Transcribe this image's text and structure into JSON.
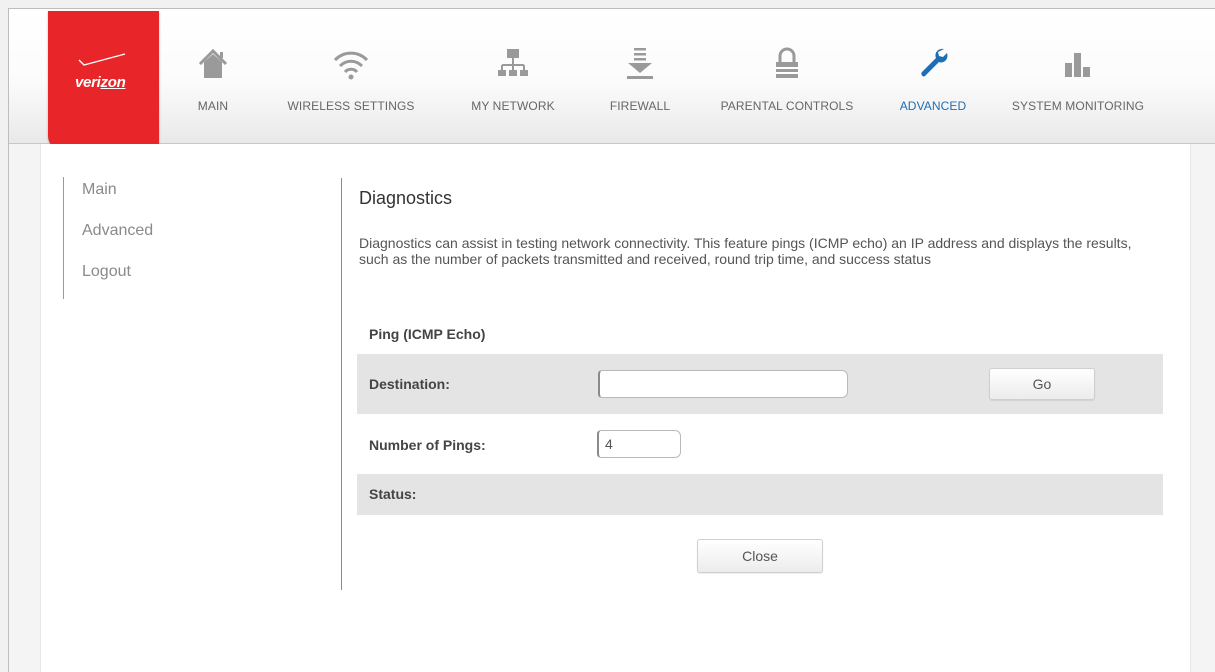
{
  "brand": {
    "logo_text_a": "veri",
    "logo_text_b": "zon"
  },
  "nav": {
    "items": [
      {
        "label": "MAIN",
        "icon": "home-icon"
      },
      {
        "label": "WIRELESS SETTINGS",
        "icon": "wifi-icon"
      },
      {
        "label": "MY NETWORK",
        "icon": "network-icon"
      },
      {
        "label": "FIREWALL",
        "icon": "firewall-icon"
      },
      {
        "label": "PARENTAL CONTROLS",
        "icon": "lock-icon"
      },
      {
        "label": "ADVANCED",
        "icon": "wrench-icon"
      },
      {
        "label": "SYSTEM MONITORING",
        "icon": "bar-chart-icon"
      }
    ],
    "active": "ADVANCED"
  },
  "sidebar": {
    "items": [
      {
        "label": "Main"
      },
      {
        "label": "Advanced"
      },
      {
        "label": "Logout"
      }
    ]
  },
  "page": {
    "title": "Diagnostics",
    "description": "Diagnostics can assist in testing network connectivity. This feature pings (ICMP echo) an IP address and displays the results, such as the number of packets transmitted and received, round trip time, and success status",
    "section_title": "Ping (ICMP Echo)",
    "destination_label": "Destination:",
    "destination_value": "",
    "go_label": "Go",
    "pings_label": "Number of Pings:",
    "pings_value": "4",
    "status_label": "Status:",
    "close_label": "Close"
  },
  "colors": {
    "brand_red": "#e8262a",
    "active_blue": "#1d6fb5",
    "icon_gray": "#9a9a9a"
  }
}
